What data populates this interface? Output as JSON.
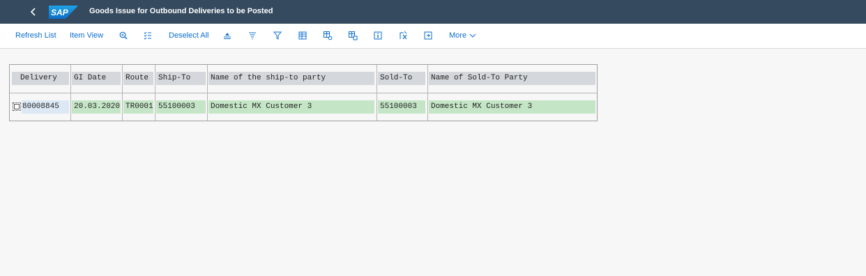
{
  "shell": {
    "title": "Goods Issue for Outbound Deliveries to be Posted",
    "back_icon": "chevron-left-icon",
    "logo": "SAP",
    "colors": {
      "shell_bg": "#354a5f",
      "link": "#0a6ed1",
      "header_cell": "#d4d8dc",
      "value_cell": "#c5e6c6",
      "key_cell": "#dce8f4"
    }
  },
  "toolbar": {
    "refresh_list": "Refresh List",
    "item_view": "Item View",
    "deselect_all": "Deselect All",
    "more": "More",
    "icons": [
      "zoom-in-icon",
      "checklist-icon",
      "sort-ascending-icon",
      "sort-descending-icon",
      "filter-icon",
      "table-icon",
      "table-settings-icon",
      "table-layout-icon",
      "info-icon",
      "export-icon",
      "print-icon",
      "chevron-down-icon"
    ]
  },
  "table": {
    "columns": [
      "Delivery",
      "GI Date",
      "Route",
      "Ship-To",
      "Name of the ship-to party",
      "Sold-To",
      "Name of Sold-To Party"
    ],
    "rows": [
      {
        "delivery": "80008845",
        "gi_date": "20.03.2020",
        "route": "TR0001",
        "ship_to": "55100003",
        "ship_to_name": "Domestic MX Customer 3",
        "sold_to": "55100003",
        "sold_to_name": "Domestic MX Customer 3"
      }
    ]
  }
}
